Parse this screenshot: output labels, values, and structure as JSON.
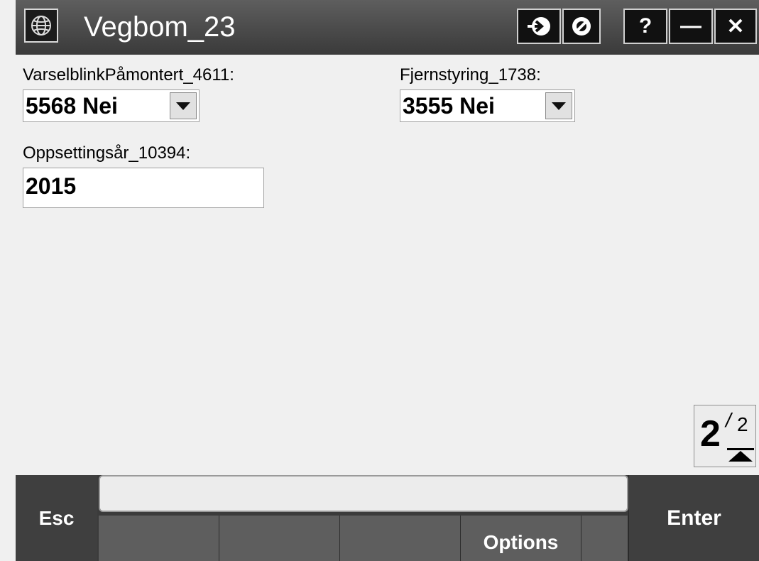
{
  "window": {
    "title": "Vegbom_23",
    "title_buttons": {
      "help": "?",
      "minimize": "—",
      "close": "✕"
    },
    "icons": [
      "trimble-globe-icon",
      "send-arrow-icon",
      "cancel-circle-icon"
    ]
  },
  "form": {
    "fields": [
      {
        "label": "VarselblinkPåmontert_4611:",
        "value": "5568 Nei",
        "type": "select"
      },
      {
        "label": "Fjernstyring_1738:",
        "value": "3555 Nei",
        "type": "select"
      },
      {
        "label": "Oppsettingsår_10394:",
        "value": "2015",
        "type": "text"
      }
    ]
  },
  "pager": {
    "current": "2",
    "slash": "/",
    "total": "2"
  },
  "bottom_bar": {
    "esc_label": "Esc",
    "enter_label": "Enter",
    "status_text": "",
    "softkeys": [
      "",
      "",
      "",
      "Options",
      ""
    ]
  },
  "colors": {
    "title_bar": "#4a4a4a",
    "background": "#f0f0f0",
    "bottom_bar": "#3b3b3b"
  }
}
